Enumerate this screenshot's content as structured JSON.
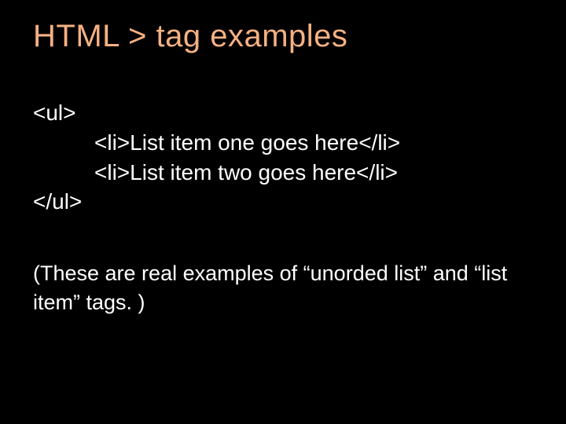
{
  "title": "HTML > tag examples",
  "code": {
    "open_ul": "<ul>",
    "li_one": "<li>List item one goes here</li>",
    "li_two": "<li>List item two goes here</li>",
    "close_ul": "</ul>"
  },
  "note_line1": "(These are real examples of “unorded list” and “list",
  "note_line2": "item” tags. )"
}
